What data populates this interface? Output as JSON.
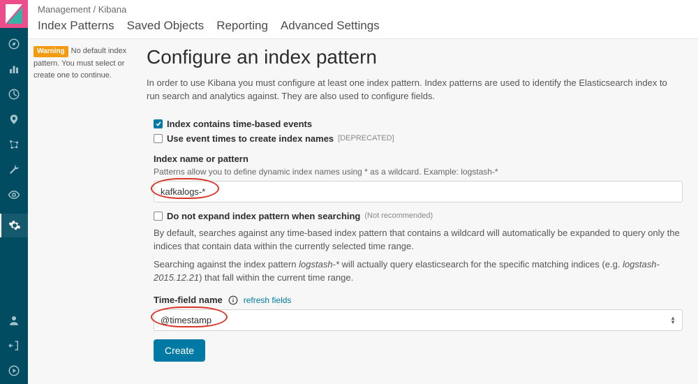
{
  "breadcrumb": {
    "section": "Management",
    "sep": " / ",
    "page": "Kibana"
  },
  "subtabs": [
    "Index Patterns",
    "Saved Objects",
    "Reporting",
    "Advanced Settings"
  ],
  "warning": {
    "badge": "Warning",
    "text": "No default index pattern. You must select or create one to continue."
  },
  "title": "Configure an index pattern",
  "description": "In order to use Kibana you must configure at least one index pattern. Index patterns are used to identify the Elasticsearch index to run search and analytics against. They are also used to configure fields.",
  "checkbox1": {
    "label": "Index contains time-based events",
    "checked": true
  },
  "checkbox2": {
    "label": "Use event times to create index names",
    "tag": "[DEPRECATED]",
    "checked": false
  },
  "index_name": {
    "label": "Index name or pattern",
    "hint": "Patterns allow you to define dynamic index names using * as a wildcard. Example: logstash-*",
    "value": "kafkalogs-*"
  },
  "checkbox3": {
    "label": "Do not expand index pattern when searching",
    "tag": "(Not recommended)",
    "checked": false
  },
  "para1_a": "By default, searches against any time-based index pattern that contains a wildcard will automatically be expanded to query only the indices that contain data within the currently selected time range.",
  "para2_a": "Searching against the index pattern ",
  "para2_em1": "logstash-*",
  "para2_b": " will actually query elasticsearch for the specific matching indices (e.g. ",
  "para2_em2": "logstash-2015.12.21",
  "para2_c": ") that fall within the current time range.",
  "timefield": {
    "label": "Time-field name",
    "refresh": "refresh fields",
    "value": "@timestamp"
  },
  "create_button": "Create",
  "rail": {
    "top": [
      "compass",
      "bar-chart",
      "globe",
      "shield",
      "network",
      "wrench",
      "eye",
      "gear"
    ],
    "bottom": [
      "user",
      "exit",
      "play"
    ]
  }
}
